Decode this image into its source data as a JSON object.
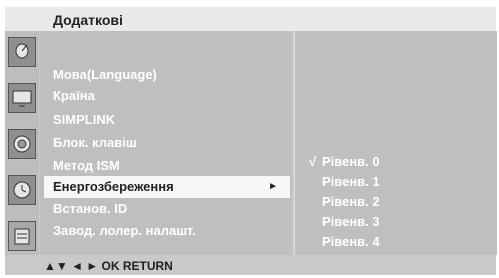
{
  "header": {
    "title": "Додаткові"
  },
  "sidebar_icons": [
    {
      "name": "satellite-dish-icon"
    },
    {
      "name": "tv-picture-icon"
    },
    {
      "name": "audio-speaker-icon"
    },
    {
      "name": "clock-icon"
    },
    {
      "name": "options-calendar-icon"
    }
  ],
  "menu": {
    "items": [
      {
        "label": "Мова(Language)"
      },
      {
        "label": "Країна"
      },
      {
        "label": "SIMPLINK"
      },
      {
        "label": "Блок. клавіш"
      },
      {
        "label": "Метод ISM"
      },
      {
        "label": "Енергозбереження",
        "selected": true,
        "arrow": "►"
      },
      {
        "label": "Встанов. ID"
      },
      {
        "label": "Завод. лолер. налашт."
      }
    ]
  },
  "submenu": {
    "options": [
      {
        "label": "Рівенв. 0",
        "checked": true,
        "check_mark": "√"
      },
      {
        "label": "Рівенв. 1"
      },
      {
        "label": "Рівенв. 2"
      },
      {
        "label": "Рівенв. 3"
      },
      {
        "label": "Рівенв. 4"
      }
    ]
  },
  "footer": {
    "hint": "▲▼ ◄ ► OK RETURN"
  }
}
